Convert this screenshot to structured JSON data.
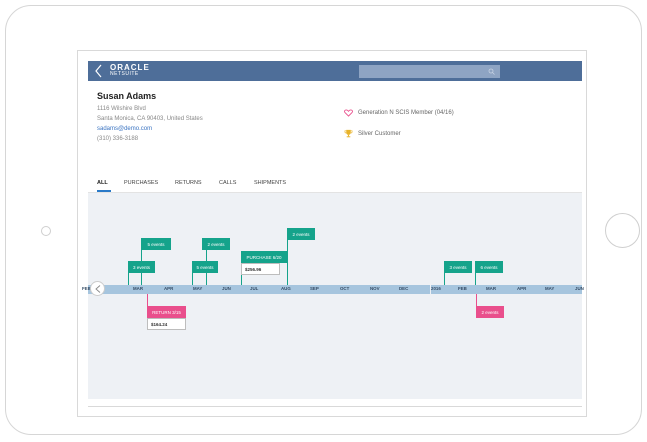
{
  "header": {
    "logo_top": "ORACLE",
    "logo_bottom": "NETSUITE",
    "search_placeholder": ""
  },
  "customer": {
    "name": "Susan Adams",
    "address_line1": "1116 Wilshire Blvd",
    "address_line2": "Santa Monica, CA 90403, United States",
    "email": "sadams@demo.com",
    "phone": "(310) 336-3188",
    "membership": "Generation N SCIS Member (04/16)",
    "tier": "Silver Customer"
  },
  "tabs": [
    "ALL",
    "PURCHASES",
    "RETURNS",
    "CALLS",
    "SHIPMENTS"
  ],
  "timeline": {
    "months": [
      "FEB",
      "MAR",
      "APR",
      "MAY",
      "JUN",
      "JUL",
      "AUG",
      "SEP",
      "OCT",
      "NOV",
      "DEC",
      "2016",
      "FEB",
      "MAR",
      "APR",
      "MAY",
      "JUN"
    ],
    "flags": {
      "f1": "3 events",
      "f2": "5 events",
      "f3": "5 events",
      "f4": "2 events",
      "f5": "PURCHASE 6/20",
      "f6": "2 events",
      "f7": "3 events",
      "f8": "6 events",
      "f9": "RETURN 3/15",
      "f10": "2 events"
    },
    "purchase_amount": "$256.96",
    "return_amount": "$164.24"
  },
  "colors": {
    "header": "#4e6e99",
    "event_green": "#15a38b",
    "event_pink": "#e94f8c",
    "axis": "#a6c5de",
    "tab_accent": "#2a7ac8"
  }
}
